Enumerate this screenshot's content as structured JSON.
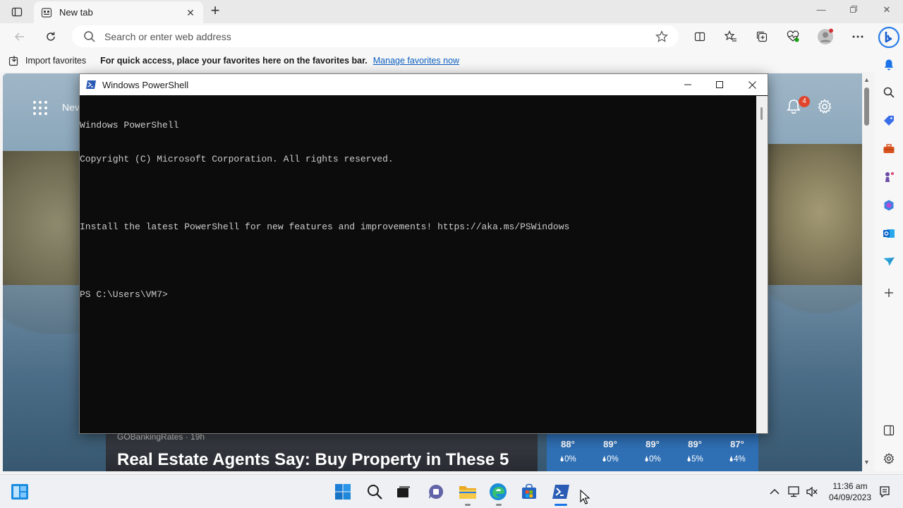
{
  "browser": {
    "tab": {
      "title": "New tab"
    },
    "address_bar": {
      "placeholder": "Search or enter web address"
    },
    "favorites_bar": {
      "import_label": "Import favorites",
      "hint": "For quick access, place your favorites here on the favorites bar.",
      "manage_link": "Manage favorites now"
    }
  },
  "new_tab_page": {
    "header_fragment": "Nev",
    "notification_count": "4",
    "news": {
      "source": "GOBankingRates · 19h",
      "title": "Real Estate Agents Say: Buy Property in These 5"
    },
    "weather": [
      {
        "temp": "88°",
        "precip": "0%"
      },
      {
        "temp": "89°",
        "precip": "0%"
      },
      {
        "temp": "89°",
        "precip": "0%"
      },
      {
        "temp": "89°",
        "precip": "5%"
      },
      {
        "temp": "87°",
        "precip": "4%"
      }
    ]
  },
  "powershell": {
    "title": "Windows PowerShell",
    "lines": [
      "Windows PowerShell",
      "Copyright (C) Microsoft Corporation. All rights reserved.",
      "",
      "Install the latest PowerShell for new features and improvements! https://aka.ms/PSWindows",
      "",
      "PS C:\\Users\\VM7>"
    ]
  },
  "taskbar": {
    "time": "11:36 am",
    "date": "04/09/2023"
  },
  "colors": {
    "accent": "#0b5fbf",
    "console_bg": "#0c0c0c",
    "console_fg": "#cccccc",
    "badge": "#e0452b",
    "weather_bg": "#2f6fb4"
  }
}
